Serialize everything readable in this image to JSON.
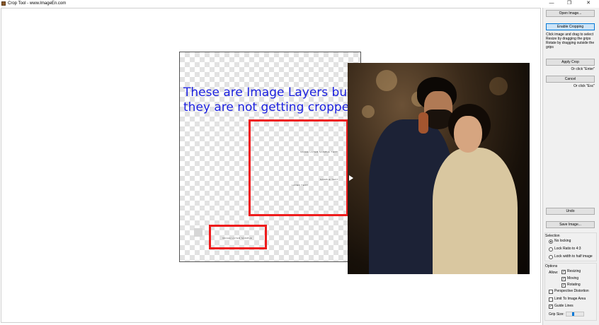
{
  "window": {
    "title": "Crop Tool - www.ImageEn.com",
    "controls": {
      "minimize": "—",
      "maximize": "❐",
      "close": "✕"
    }
  },
  "canvas": {
    "annotation_line1": "These are Image Layers but",
    "annotation_line2": "they are not getting cropped",
    "layer_texts": [
      "IMAGE LAYER SAMPLE TEXT",
      "LAYER TEXT",
      "SAMPLE TEXT",
      "IMAGE LAYER SAMPLE"
    ],
    "colors": {
      "annotation": "#1d22e0",
      "highlight": "#ee1c1c"
    }
  },
  "sidebar": {
    "open_image": "Open Image...",
    "enable_cropping": "Enable Cropping",
    "help_text": "Click image and drag to select Resize by dragging the grips Rotate by dragging outside the grips",
    "apply_crop": "Apply Crop",
    "apply_hint": "Or click \"Enter\"",
    "cancel": "Cancel",
    "cancel_hint": "Or click \"Esc\"",
    "undo": "Undo",
    "save_image": "Save Image...",
    "selection": {
      "title": "Selection",
      "options": [
        "No locking",
        "Lock Ratio to 4:3",
        "Lock width to half image"
      ],
      "selected_index": 0
    },
    "options": {
      "title": "Options",
      "allow_label": "Allow:",
      "allow_items": [
        {
          "label": "Resizing",
          "checked": true
        },
        {
          "label": "Moving",
          "checked": true
        },
        {
          "label": "Rotating",
          "checked": true
        }
      ],
      "checkboxes": [
        {
          "label": "Perspective Distortion",
          "checked": false
        },
        {
          "label": "Limit To Image Area",
          "checked": false
        },
        {
          "label": "Guide Lines",
          "checked": true
        }
      ],
      "grip_size_label": "Grip Size:",
      "grip_size_fraction": 0.35
    }
  }
}
